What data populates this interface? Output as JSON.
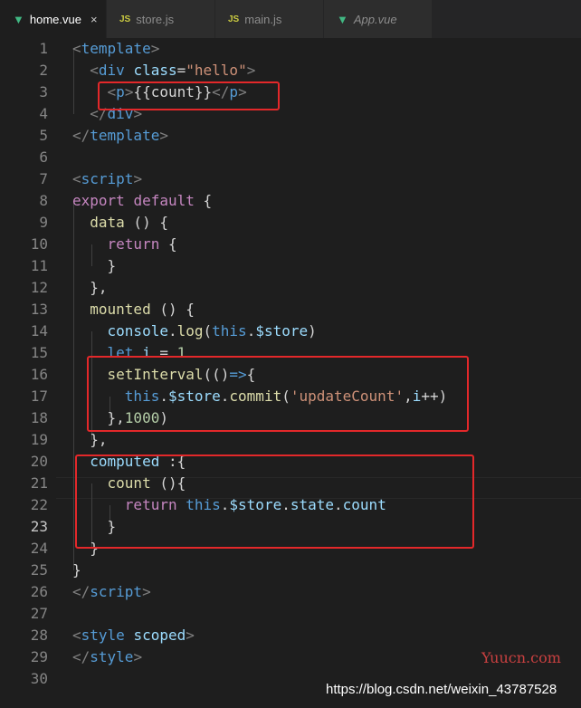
{
  "tabs": [
    {
      "label": "home.vue",
      "icon": "vue-icon",
      "active": true,
      "close": "×"
    },
    {
      "label": "store.js",
      "icon": "js-icon",
      "active": false
    },
    {
      "label": "main.js",
      "icon": "js-icon",
      "active": false
    },
    {
      "label": "App.vue",
      "icon": "vue-icon",
      "active": false
    }
  ],
  "icons": {
    "vue": "▼",
    "js": "JS"
  },
  "current_line": 23,
  "lines": [
    {
      "n": "1",
      "tokens": [
        [
          "t-punct",
          "<"
        ],
        [
          "t-tag",
          "template"
        ],
        [
          "t-punct",
          ">"
        ]
      ]
    },
    {
      "n": "2",
      "tokens": [
        [
          "t-def",
          "  "
        ],
        [
          "t-punct",
          "<"
        ],
        [
          "t-tag",
          "div"
        ],
        [
          "t-def",
          " "
        ],
        [
          "t-attr",
          "class"
        ],
        [
          "t-def",
          "="
        ],
        [
          "t-str",
          "\"hello\""
        ],
        [
          "t-punct",
          ">"
        ]
      ]
    },
    {
      "n": "3",
      "tokens": [
        [
          "t-def",
          "    "
        ],
        [
          "t-punct",
          "<"
        ],
        [
          "t-tag",
          "p"
        ],
        [
          "t-punct",
          ">"
        ],
        [
          "t-def",
          "{{count}}"
        ],
        [
          "t-punct",
          "</"
        ],
        [
          "t-tag",
          "p"
        ],
        [
          "t-punct",
          ">"
        ]
      ]
    },
    {
      "n": "4",
      "tokens": [
        [
          "t-def",
          "  "
        ],
        [
          "t-punct",
          "</"
        ],
        [
          "t-tag",
          "div"
        ],
        [
          "t-punct",
          ">"
        ]
      ]
    },
    {
      "n": "5",
      "tokens": [
        [
          "t-punct",
          "</"
        ],
        [
          "t-tag",
          "template"
        ],
        [
          "t-punct",
          ">"
        ]
      ]
    },
    {
      "n": "6",
      "tokens": []
    },
    {
      "n": "7",
      "tokens": [
        [
          "t-punct",
          "<"
        ],
        [
          "t-tag",
          "script"
        ],
        [
          "t-punct",
          ">"
        ]
      ]
    },
    {
      "n": "8",
      "tokens": [
        [
          "t-kw",
          "export"
        ],
        [
          "t-def",
          " "
        ],
        [
          "t-kw",
          "default"
        ],
        [
          "t-def",
          " {"
        ]
      ]
    },
    {
      "n": "9",
      "tokens": [
        [
          "t-def",
          "  "
        ],
        [
          "t-fn",
          "data"
        ],
        [
          "t-def",
          " () {"
        ]
      ]
    },
    {
      "n": "10",
      "tokens": [
        [
          "t-def",
          "    "
        ],
        [
          "t-kw",
          "return"
        ],
        [
          "t-def",
          " {"
        ]
      ]
    },
    {
      "n": "11",
      "tokens": [
        [
          "t-def",
          "    }"
        ]
      ]
    },
    {
      "n": "12",
      "tokens": [
        [
          "t-def",
          "  },"
        ]
      ]
    },
    {
      "n": "13",
      "tokens": [
        [
          "t-def",
          "  "
        ],
        [
          "t-fn",
          "mounted"
        ],
        [
          "t-def",
          " () {"
        ]
      ]
    },
    {
      "n": "14",
      "tokens": [
        [
          "t-def",
          "    "
        ],
        [
          "t-var",
          "console"
        ],
        [
          "t-def",
          "."
        ],
        [
          "t-fn",
          "log"
        ],
        [
          "t-def",
          "("
        ],
        [
          "t-this",
          "this"
        ],
        [
          "t-def",
          "."
        ],
        [
          "t-var",
          "$store"
        ],
        [
          "t-def",
          ")"
        ]
      ]
    },
    {
      "n": "15",
      "tokens": [
        [
          "t-def",
          "    "
        ],
        [
          "t-this",
          "let"
        ],
        [
          "t-def",
          " "
        ],
        [
          "t-var",
          "i"
        ],
        [
          "t-def",
          " = "
        ],
        [
          "t-num",
          "1"
        ]
      ]
    },
    {
      "n": "16",
      "tokens": [
        [
          "t-def",
          "    "
        ],
        [
          "t-fn",
          "setInterval"
        ],
        [
          "t-def",
          "(()"
        ],
        [
          "t-this",
          "=>"
        ],
        [
          "t-def",
          "{"
        ]
      ]
    },
    {
      "n": "17",
      "tokens": [
        [
          "t-def",
          "      "
        ],
        [
          "t-this",
          "this"
        ],
        [
          "t-def",
          "."
        ],
        [
          "t-var",
          "$store"
        ],
        [
          "t-def",
          "."
        ],
        [
          "t-fn",
          "commit"
        ],
        [
          "t-def",
          "("
        ],
        [
          "t-str",
          "'updateCount'"
        ],
        [
          "t-def",
          ","
        ],
        [
          "t-var",
          "i"
        ],
        [
          "t-def",
          "++)"
        ]
      ]
    },
    {
      "n": "18",
      "tokens": [
        [
          "t-def",
          "    },"
        ],
        [
          "t-num",
          "1000"
        ],
        [
          "t-def",
          ")"
        ]
      ]
    },
    {
      "n": "19",
      "tokens": [
        [
          "t-def",
          "  },"
        ]
      ]
    },
    {
      "n": "20",
      "tokens": [
        [
          "t-def",
          "  "
        ],
        [
          "t-var",
          "computed"
        ],
        [
          "t-def",
          " :{"
        ]
      ]
    },
    {
      "n": "21",
      "tokens": [
        [
          "t-def",
          "    "
        ],
        [
          "t-fn",
          "count"
        ],
        [
          "t-def",
          " (){"
        ]
      ]
    },
    {
      "n": "22",
      "tokens": [
        [
          "t-def",
          "      "
        ],
        [
          "t-kw",
          "return"
        ],
        [
          "t-def",
          " "
        ],
        [
          "t-this",
          "this"
        ],
        [
          "t-def",
          "."
        ],
        [
          "t-var",
          "$store"
        ],
        [
          "t-def",
          "."
        ],
        [
          "t-var",
          "state"
        ],
        [
          "t-def",
          "."
        ],
        [
          "t-var",
          "count"
        ]
      ]
    },
    {
      "n": "23",
      "tokens": [
        [
          "t-def",
          "    }"
        ]
      ]
    },
    {
      "n": "24",
      "tokens": [
        [
          "t-def",
          "  }"
        ]
      ]
    },
    {
      "n": "25",
      "tokens": [
        [
          "t-def",
          "}"
        ]
      ]
    },
    {
      "n": "26",
      "tokens": [
        [
          "t-punct",
          "</"
        ],
        [
          "t-tag",
          "script"
        ],
        [
          "t-punct",
          ">"
        ]
      ]
    },
    {
      "n": "27",
      "tokens": []
    },
    {
      "n": "28",
      "tokens": [
        [
          "t-punct",
          "<"
        ],
        [
          "t-tag",
          "style"
        ],
        [
          "t-def",
          " "
        ],
        [
          "t-attr",
          "scoped"
        ],
        [
          "t-punct",
          ">"
        ]
      ]
    },
    {
      "n": "29",
      "tokens": [
        [
          "t-punct",
          "</"
        ],
        [
          "t-tag",
          "style"
        ],
        [
          "t-punct",
          ">"
        ]
      ]
    },
    {
      "n": "30",
      "tokens": []
    }
  ],
  "watermark": "Yuucn.com",
  "footer_url": "https://blog.csdn.net/weixin_43787528"
}
